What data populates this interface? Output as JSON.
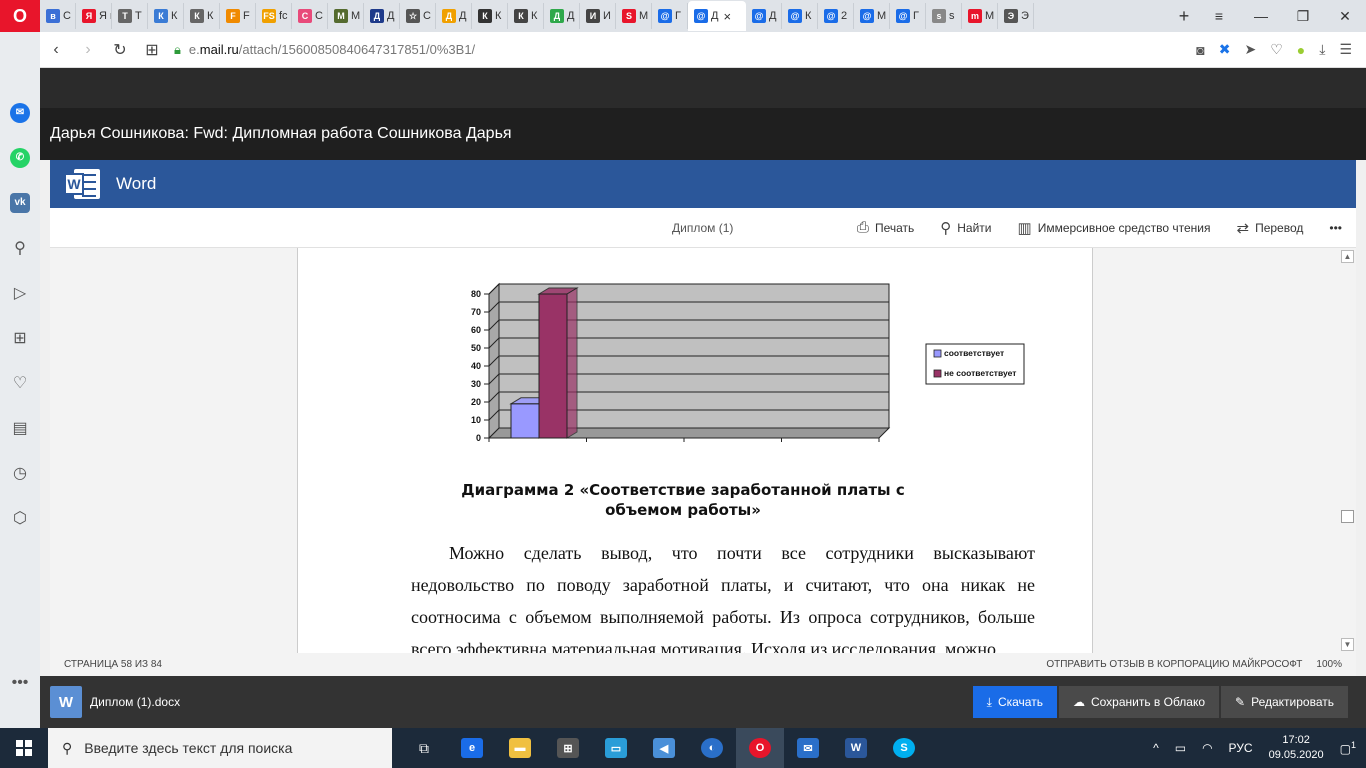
{
  "browser": {
    "logo": "O",
    "tabs": [
      {
        "label": "С",
        "icon_color": "#3b6fd6",
        "icon_char": "в"
      },
      {
        "label": "Я к",
        "icon_color": "#e8152b",
        "icon_char": "Я"
      },
      {
        "label": "Т",
        "icon_color": "#666666",
        "icon_char": "Т"
      },
      {
        "label": "К",
        "icon_color": "#3a7bd5",
        "icon_char": "К"
      },
      {
        "label": "К",
        "icon_color": "#666666",
        "icon_char": "К"
      },
      {
        "label": "F",
        "icon_color": "#f08a00",
        "icon_char": "F"
      },
      {
        "label": "fc",
        "icon_color": "#f0a000",
        "icon_char": "FS"
      },
      {
        "label": "С",
        "icon_color": "#e84a7a",
        "icon_char": "С"
      },
      {
        "label": "M",
        "icon_color": "#556b2f",
        "icon_char": "M"
      },
      {
        "label": "Д",
        "icon_color": "#1e3a8a",
        "icon_char": "Д"
      },
      {
        "label": "С",
        "icon_color": "#555555",
        "icon_char": "☆"
      },
      {
        "label": "Д",
        "icon_color": "#f0a000",
        "icon_char": "Д"
      },
      {
        "label": "К",
        "icon_color": "#333333",
        "icon_char": "К"
      },
      {
        "label": "К",
        "icon_color": "#444444",
        "icon_char": "К"
      },
      {
        "label": "Д",
        "icon_color": "#2ea84a",
        "icon_char": "Д"
      },
      {
        "label": "И",
        "icon_color": "#444444",
        "icon_char": "И"
      },
      {
        "label": "M",
        "icon_color": "#e8152b",
        "icon_char": "S"
      },
      {
        "label": "Г",
        "icon_color": "#1a6ce8",
        "icon_char": "@"
      },
      {
        "label": "Д",
        "icon_color": "#1a6ce8",
        "icon_char": "@",
        "active": true
      },
      {
        "label": "Д",
        "icon_color": "#1a6ce8",
        "icon_char": "@"
      },
      {
        "label": "К",
        "icon_color": "#1a6ce8",
        "icon_char": "@"
      },
      {
        "label": "2",
        "icon_color": "#1a6ce8",
        "icon_char": "@"
      },
      {
        "label": "M",
        "icon_color": "#1a6ce8",
        "icon_char": "@"
      },
      {
        "label": "Г",
        "icon_color": "#1a6ce8",
        "icon_char": "@"
      },
      {
        "label": "s",
        "icon_color": "#888888",
        "icon_char": "s"
      },
      {
        "label": "M",
        "icon_color": "#e8152b",
        "icon_char": "m"
      },
      {
        "label": "Э",
        "icon_color": "#555555",
        "icon_char": "Э"
      }
    ],
    "url_prefix": "e.",
    "url_host": "mail.ru",
    "url_path": "/attach/15600850840647317851/0%3B1/"
  },
  "sidebar": [
    {
      "name": "messenger-icon",
      "color": "#1a73e8",
      "char": "m"
    },
    {
      "name": "whatsapp-icon",
      "color": "#25d366",
      "char": "w"
    },
    {
      "name": "vk-icon",
      "color": "#4a76a8",
      "char": "vk"
    }
  ],
  "mail": {
    "title": "Дарья Сошникова: Fwd: Дипломная работа Сошникова Дарья"
  },
  "word": {
    "app_label": "Word",
    "doc_name": "Диплом (1)",
    "actions": {
      "print": "Печать",
      "find": "Найти",
      "immersive": "Иммерсивное средство чтения",
      "translate": "Перевод",
      "more": "•••"
    }
  },
  "chart_data": {
    "type": "bar",
    "categories": [
      ""
    ],
    "series": [
      {
        "name": "соответствует",
        "values": [
          19
        ],
        "color": "#9999ff"
      },
      {
        "name": "не соответствует",
        "values": [
          80
        ],
        "color": "#993366"
      }
    ],
    "yticks": [
      "0",
      "10",
      "20",
      "30",
      "40",
      "50",
      "60",
      "70",
      "80"
    ],
    "ylim": [
      0,
      80
    ],
    "grid": true,
    "legend": "right",
    "style": "3d"
  },
  "document": {
    "caption": "Диаграмма 2 «Соответствие заработанной платы с объемом работы»",
    "paragraph": "Можно сделать вывод, что почти все сотрудники высказывают недовольство по поводу заработной платы, и считают, что она никак не соотносима с объемом выполняемой работы. Из опроса сотрудников, больше всего эффективна материальная мотивация. Исходя из исследования, можно"
  },
  "status": {
    "page": "СТРАНИЦА 58 ИЗ 84",
    "feedback": "ОТПРАВИТЬ ОТЗЫВ В КОРПОРАЦИЮ МАЙКРОСОФТ",
    "zoom": "100%"
  },
  "attachment": {
    "name": "Диплом (1).docx",
    "download": "Скачать",
    "save_cloud": "Сохранить в Облако",
    "edit": "Редактировать"
  },
  "taskbar": {
    "search_placeholder": "Введите здесь текст для поиска",
    "lang": "РУС",
    "time": "17:02",
    "date": "09.05.2020",
    "notifications": "1"
  }
}
